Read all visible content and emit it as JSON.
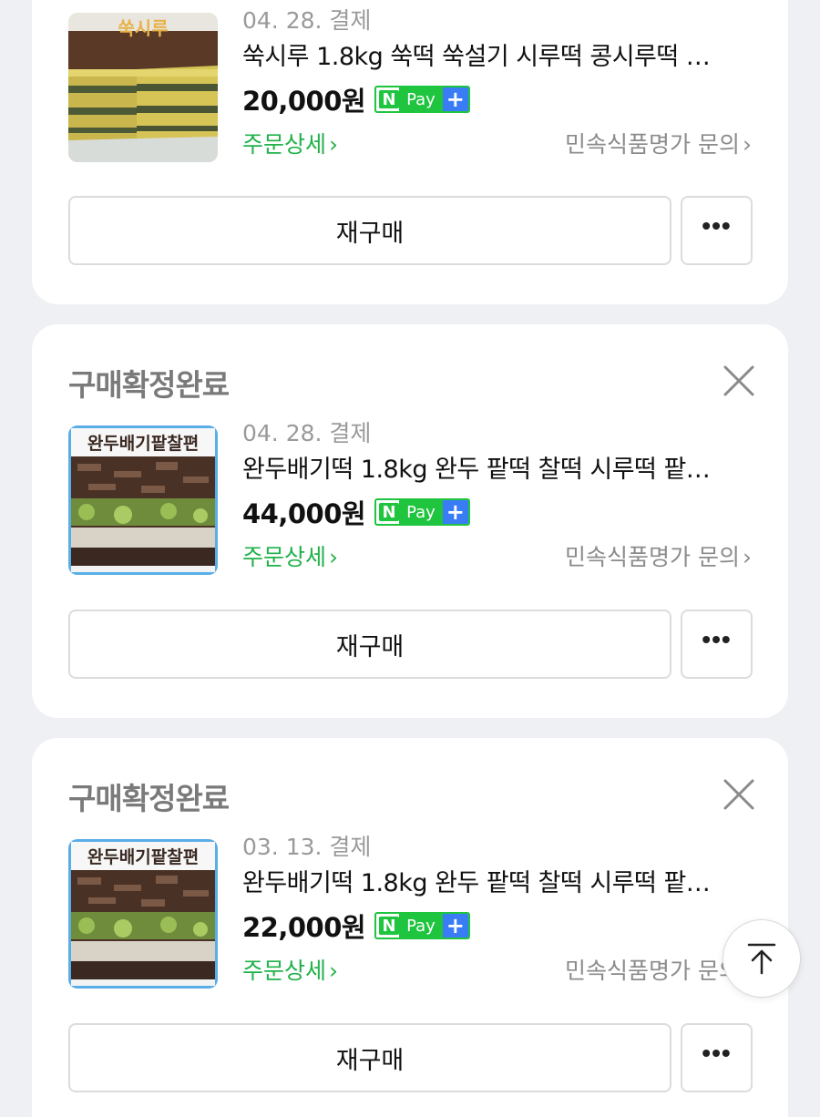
{
  "accent_green": "#20b24a",
  "orders": [
    {
      "status": "",
      "date": "04. 28. 결제",
      "title": "쑥시루 1.8kg 쑥떡 쑥설기 시루떡 콩시루떡 …",
      "price": "20,000원",
      "thumb_label": "쑥시루",
      "detail_link": "주문상세",
      "seller_link": "민속식품명가 문의",
      "rebuy_label": "재구매",
      "more_label": "•••"
    },
    {
      "status": "구매확정완료",
      "date": "04. 28. 결제",
      "title": "완두배기떡 1.8kg 완두 팥떡 찰떡 시루떡 팥…",
      "price": "44,000원",
      "thumb_label": "완두배기팥찰편",
      "detail_link": "주문상세",
      "seller_link": "민속식품명가 문의",
      "rebuy_label": "재구매",
      "more_label": "•••"
    },
    {
      "status": "구매확정완료",
      "date": "03. 13. 결제",
      "title": "완두배기떡 1.8kg 완두 팥떡 찰떡 시루떡 팥…",
      "price": "22,000원",
      "thumb_label": "완두배기팥찰편",
      "detail_link": "주문상세",
      "seller_link": "민속식품명가 문의",
      "rebuy_label": "재구매",
      "more_label": "•••"
    }
  ],
  "npay": {
    "n": "N",
    "pay": "Pay",
    "plus": "+"
  },
  "icons": {
    "close": "close-icon",
    "scroll_top": "arrow-up-to-top-icon",
    "chevron": "chevron-right-icon"
  }
}
